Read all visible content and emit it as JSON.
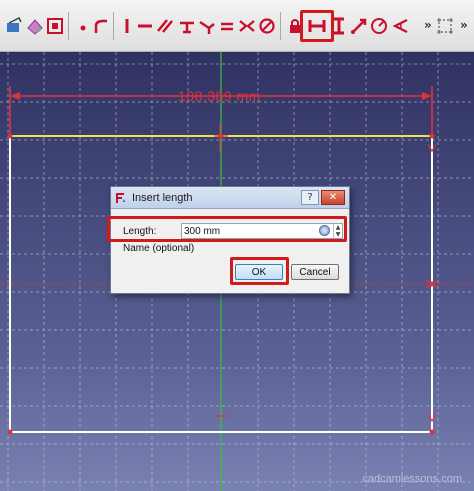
{
  "toolbar": {
    "more_glyph_1": "»",
    "more_glyph_2": "»",
    "buttons": [
      "view-sketch-icon",
      "map-sketch-icon",
      "reorient-sketch-icon",
      "point-icon",
      "arc-corner-icon",
      "line-icon",
      "polyline-icon",
      "fillet-icon",
      "horizontal-constraint-icon",
      "tangent-constraint-icon",
      "equal-constraint-icon",
      "symmetric-constraint-icon",
      "block-constraint-icon",
      "lock-constraint-icon",
      "horizontal-distance-icon",
      "vertical-distance-icon",
      "distance-icon",
      "radius-icon",
      "angle-icon",
      "construction-toggle-icon"
    ]
  },
  "canvas": {
    "dimension_label": "108,389 mm",
    "watermark": "cadcamlessons.com",
    "colors": {
      "dimension": "#e0323a",
      "selected_line": "#e8e64a",
      "sketch_line": "#ffffff",
      "axis_vertical": "#3fbf3f",
      "axis_horizontal": "#e0323a"
    }
  },
  "dialog": {
    "title": "Insert length",
    "help_glyph": "?",
    "close_glyph": "✕",
    "length_label": "Length:",
    "length_value": "300 mm",
    "name_label": "Name (optional)",
    "ok_label": "OK",
    "cancel_label": "Cancel"
  }
}
